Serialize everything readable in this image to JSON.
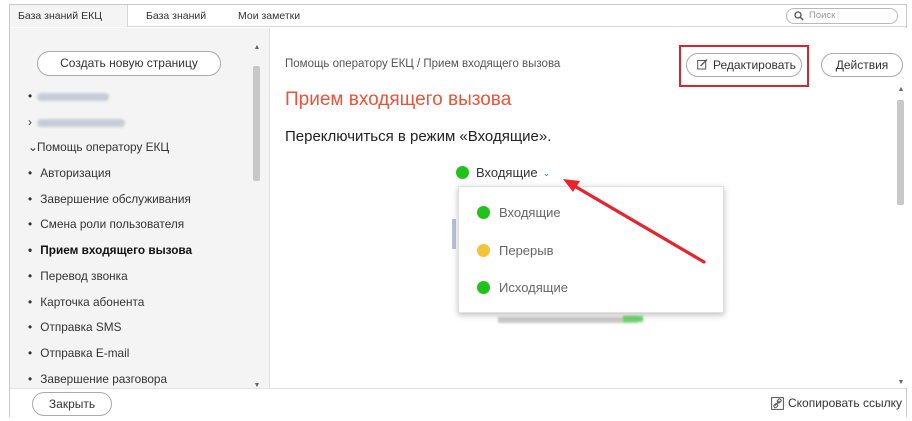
{
  "tabs": [
    {
      "label": "База знаний ЕКЦ",
      "active": true
    },
    {
      "label": "База знаний",
      "active": false
    },
    {
      "label": "Мои заметки",
      "active": false
    }
  ],
  "search": {
    "placeholder": "Поиск",
    "icon": "search-icon"
  },
  "sidebar": {
    "create_label": "Создать новую страницу",
    "items": [
      {
        "type": "bullet",
        "label": "",
        "blurred": true
      },
      {
        "type": "collapsed",
        "label": "",
        "blurred": true
      },
      {
        "type": "expanded",
        "label": "Помощь оператору ЕКЦ"
      },
      {
        "type": "bullet",
        "label": "Авторизация"
      },
      {
        "type": "bullet",
        "label": "Завершение обслуживания"
      },
      {
        "type": "bullet",
        "label": "Смена роли пользователя"
      },
      {
        "type": "bullet",
        "label": "Прием входящего вызова",
        "current": true
      },
      {
        "type": "bullet",
        "label": "Перевод звонка"
      },
      {
        "type": "bullet",
        "label": "Карточка абонента"
      },
      {
        "type": "bullet",
        "label": "Отправка SMS"
      },
      {
        "type": "bullet",
        "label": "Отправка E-mail"
      },
      {
        "type": "bullet",
        "label": "Завершение разговора"
      }
    ]
  },
  "main": {
    "breadcrumb": "Помощь оператору ЕКЦ / Прием входящего вызова",
    "edit_label": "Редактировать",
    "actions_label": "Действия",
    "title": "Прием входящего вызова",
    "instruction": "Переключиться в режим «Входящие».",
    "status_dropdown": {
      "current": "Входящие",
      "options": [
        {
          "label": "Входящие",
          "color": "#21c21a"
        },
        {
          "label": "Перерыв",
          "color": "#f3c43a"
        },
        {
          "label": "Исходящие",
          "color": "#21c21a"
        }
      ]
    }
  },
  "footer": {
    "close_label": "Закрыть",
    "copy_link_label": "Скопировать ссылку"
  },
  "colors": {
    "title": "#e8543a",
    "highlight": "#d7262e",
    "arrow": "#e8232b",
    "status_green": "#21c21a",
    "status_yellow": "#f3c43a"
  }
}
